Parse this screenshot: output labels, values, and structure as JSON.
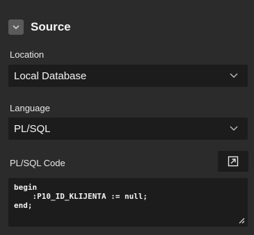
{
  "section": {
    "title": "Source",
    "collapse_icon": "chevron-down-icon"
  },
  "location": {
    "label": "Location",
    "value": "Local Database"
  },
  "language": {
    "label": "Language",
    "value": "PL/SQL"
  },
  "code": {
    "label": "PL/SQL Code",
    "expand_icon": "expand-icon",
    "lines": [
      "begin",
      "    :P10_ID_KLIJENTA := null;",
      "end;"
    ]
  },
  "colors": {
    "background": "#2b2b2b",
    "field_bg": "#1c1c1c",
    "collapse_button": "#5a5a5a"
  }
}
